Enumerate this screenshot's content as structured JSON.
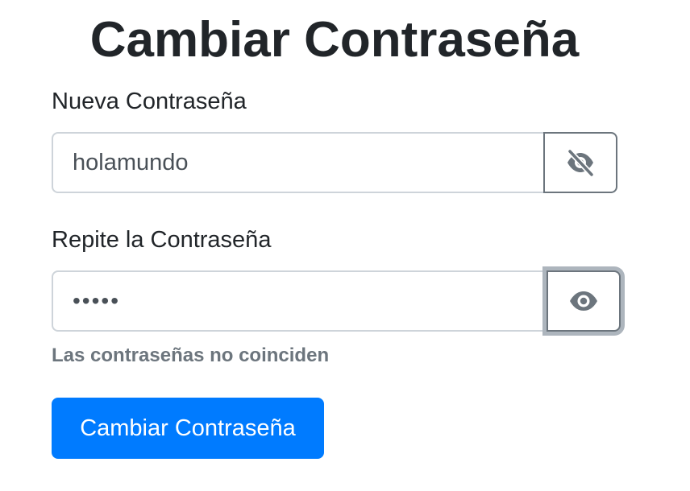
{
  "page": {
    "title": "Cambiar Contraseña"
  },
  "new_password": {
    "label": "Nueva Contraseña",
    "value": "holamundo",
    "visible": true,
    "toggle_icon": "eye-slash-icon"
  },
  "repeat_password": {
    "label": "Repite la Contraseña",
    "value": "•••••",
    "visible": false,
    "toggle_icon": "eye-icon"
  },
  "validation": {
    "error": "Las contraseñas no coinciden"
  },
  "submit": {
    "label": "Cambiar Contraseña"
  },
  "colors": {
    "primary": "#007bff",
    "text": "#212529",
    "muted": "#6c757d",
    "border": "#ced4da"
  }
}
